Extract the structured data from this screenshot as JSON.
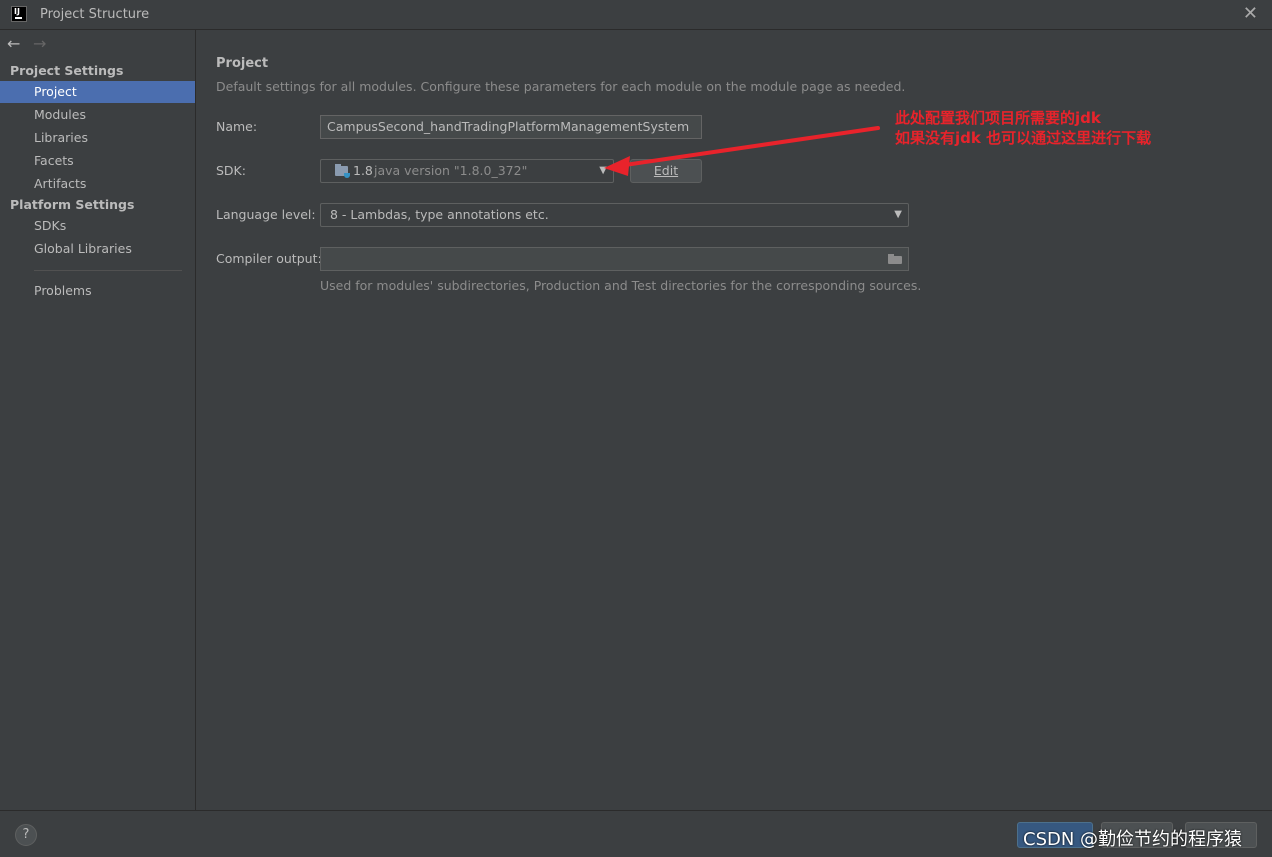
{
  "window": {
    "title": "Project Structure"
  },
  "sidebar": {
    "sections": [
      {
        "header": "Project Settings",
        "items": [
          "Project",
          "Modules",
          "Libraries",
          "Facets",
          "Artifacts"
        ]
      },
      {
        "header": "Platform Settings",
        "items": [
          "SDKs",
          "Global Libraries"
        ]
      }
    ],
    "problems": "Problems",
    "selected": "Project"
  },
  "main": {
    "heading": "Project",
    "description": "Default settings for all modules. Configure these parameters for each module on the module page as needed.",
    "name_label": "Name:",
    "name_value": "CampusSecond_handTradingPlatformManagementSystem",
    "sdk_label": "SDK:",
    "sdk_version": "1.8",
    "sdk_detail": "java version \"1.8.0_372\"",
    "edit_label": "Edit",
    "language_label": "Language level:",
    "language_value": "8 - Lambdas, type annotations etc.",
    "compiler_label": "Compiler output:",
    "compiler_value": "",
    "compiler_hint": "Used for modules' subdirectories, Production and Test directories for the corresponding sources."
  },
  "annotation": {
    "line1": "此处配置我们项目所需要的jdk",
    "line2": "如果没有jdk 也可以通过这里进行下载",
    "color": "#e8232b"
  },
  "footer": {
    "help_label": "?",
    "watermark": "CSDN @勤俭节约的程序猿"
  },
  "colors": {
    "background": "#3c3f41",
    "selection": "#4b6eaf",
    "text": "#bbbbbb"
  }
}
